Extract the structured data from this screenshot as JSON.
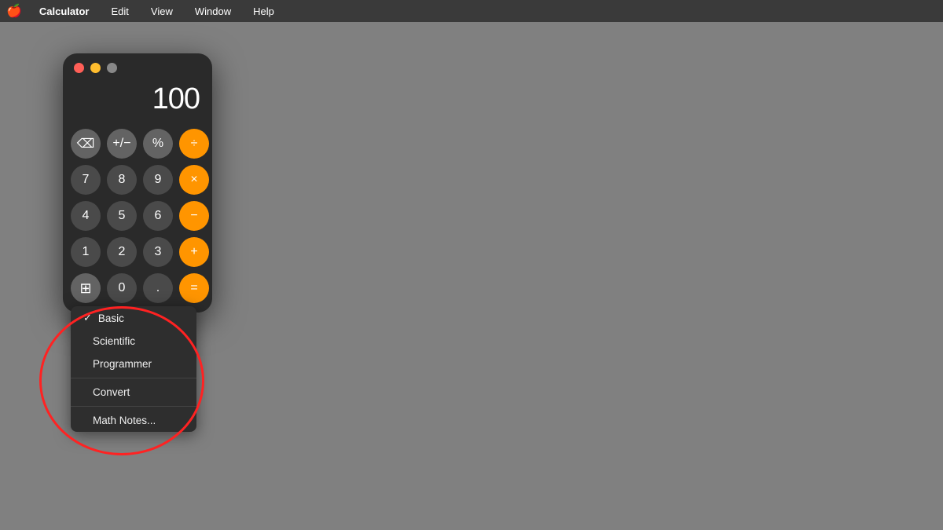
{
  "menubar": {
    "apple": "🍎",
    "app_name": "Calculator",
    "items": [
      "Calculator",
      "Edit",
      "View",
      "Window",
      "Help"
    ]
  },
  "window": {
    "traffic_lights": {
      "close": "close",
      "minimize": "minimize",
      "maximize": "maximize"
    },
    "display_value": "100"
  },
  "buttons": {
    "row1": [
      {
        "label": "⌫",
        "type": "gray"
      },
      {
        "label": "+/−",
        "type": "gray"
      },
      {
        "label": "%",
        "type": "gray"
      },
      {
        "label": "÷",
        "type": "orange"
      }
    ],
    "row2": [
      {
        "label": "7",
        "type": "dark"
      },
      {
        "label": "8",
        "type": "dark"
      },
      {
        "label": "9",
        "type": "dark"
      },
      {
        "label": "×",
        "type": "orange"
      }
    ],
    "row3": [
      {
        "label": "4",
        "type": "dark"
      },
      {
        "label": "5",
        "type": "dark"
      },
      {
        "label": "6",
        "type": "dark"
      },
      {
        "label": "−",
        "type": "orange"
      }
    ],
    "row4": [
      {
        "label": "1",
        "type": "dark"
      },
      {
        "label": "2",
        "type": "dark"
      },
      {
        "label": "3",
        "type": "dark"
      },
      {
        "label": "+",
        "type": "orange"
      }
    ],
    "row5": [
      {
        "label": "⊞",
        "type": "gray"
      },
      {
        "label": "0",
        "type": "dark"
      },
      {
        "label": ".",
        "type": "dark"
      },
      {
        "label": "=",
        "type": "orange"
      }
    ]
  },
  "menu": {
    "items": [
      {
        "label": "Basic",
        "checked": true,
        "separator_before": false,
        "separator_after": false
      },
      {
        "label": "Scientific",
        "checked": false,
        "separator_before": false,
        "separator_after": false
      },
      {
        "label": "Programmer",
        "checked": false,
        "separator_before": false,
        "separator_after": true
      },
      {
        "label": "Convert",
        "checked": false,
        "separator_before": false,
        "separator_after": true
      },
      {
        "label": "Math Notes...",
        "checked": false,
        "separator_before": false,
        "separator_after": false
      }
    ]
  }
}
